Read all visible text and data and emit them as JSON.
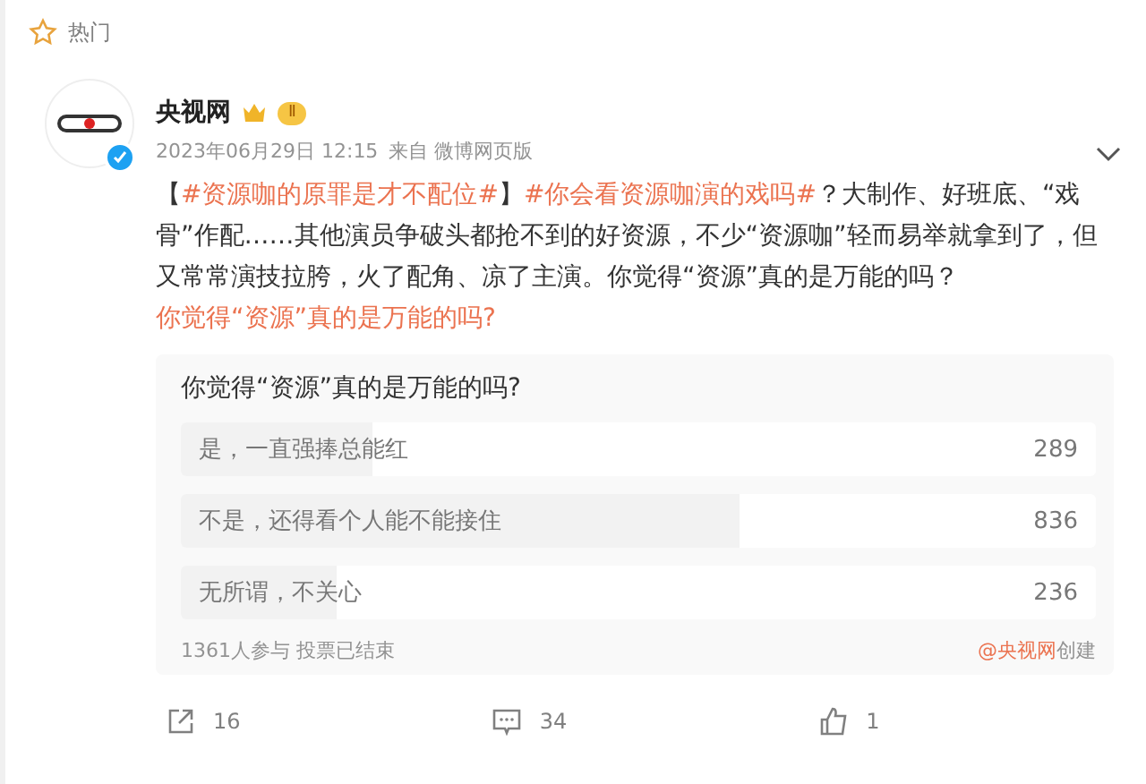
{
  "header": {
    "title": "热门"
  },
  "post": {
    "author": "央视网",
    "badge": "Ⅱ",
    "verified": true,
    "time": "2023年06月29日 12:15",
    "source": "来自 微博网页版",
    "body": [
      {
        "kind": "plain",
        "text": "【"
      },
      {
        "kind": "topic",
        "text": "#资源咖的原罪是才不配位#"
      },
      {
        "kind": "plain",
        "text": "】"
      },
      {
        "kind": "topic",
        "text": "#你会看资源咖演的戏吗#"
      },
      {
        "kind": "plain",
        "text": "？大制作、好班底、“戏骨”作配……其他演员争破头都抢不到的好资源，不少“资源咖”轻而易举就拿到了，但又常常演技拉胯，火了配角、凉了主演。你觉得“资源”真的是万能的吗？ "
      },
      {
        "kind": "topic",
        "text": "你觉得“资源”真的是万能的吗?"
      }
    ],
    "poll": {
      "question": "你觉得“资源”真的是万能的吗?",
      "options": [
        {
          "label": "是，一直强捧总能红",
          "count": "289",
          "level": 0.21
        },
        {
          "label": "不是，还得看个人能不能接住",
          "count": "836",
          "level": 0.61
        },
        {
          "label": "无所谓，不关心",
          "count": "236",
          "level": 0.17
        }
      ],
      "status": "1361人参与 投票已结束",
      "creator": "@央视网",
      "created": "创建"
    },
    "actions": [
      {
        "kind": "share",
        "count": "16"
      },
      {
        "kind": "comment",
        "count": "34"
      },
      {
        "kind": "like",
        "count": "1"
      }
    ]
  }
}
